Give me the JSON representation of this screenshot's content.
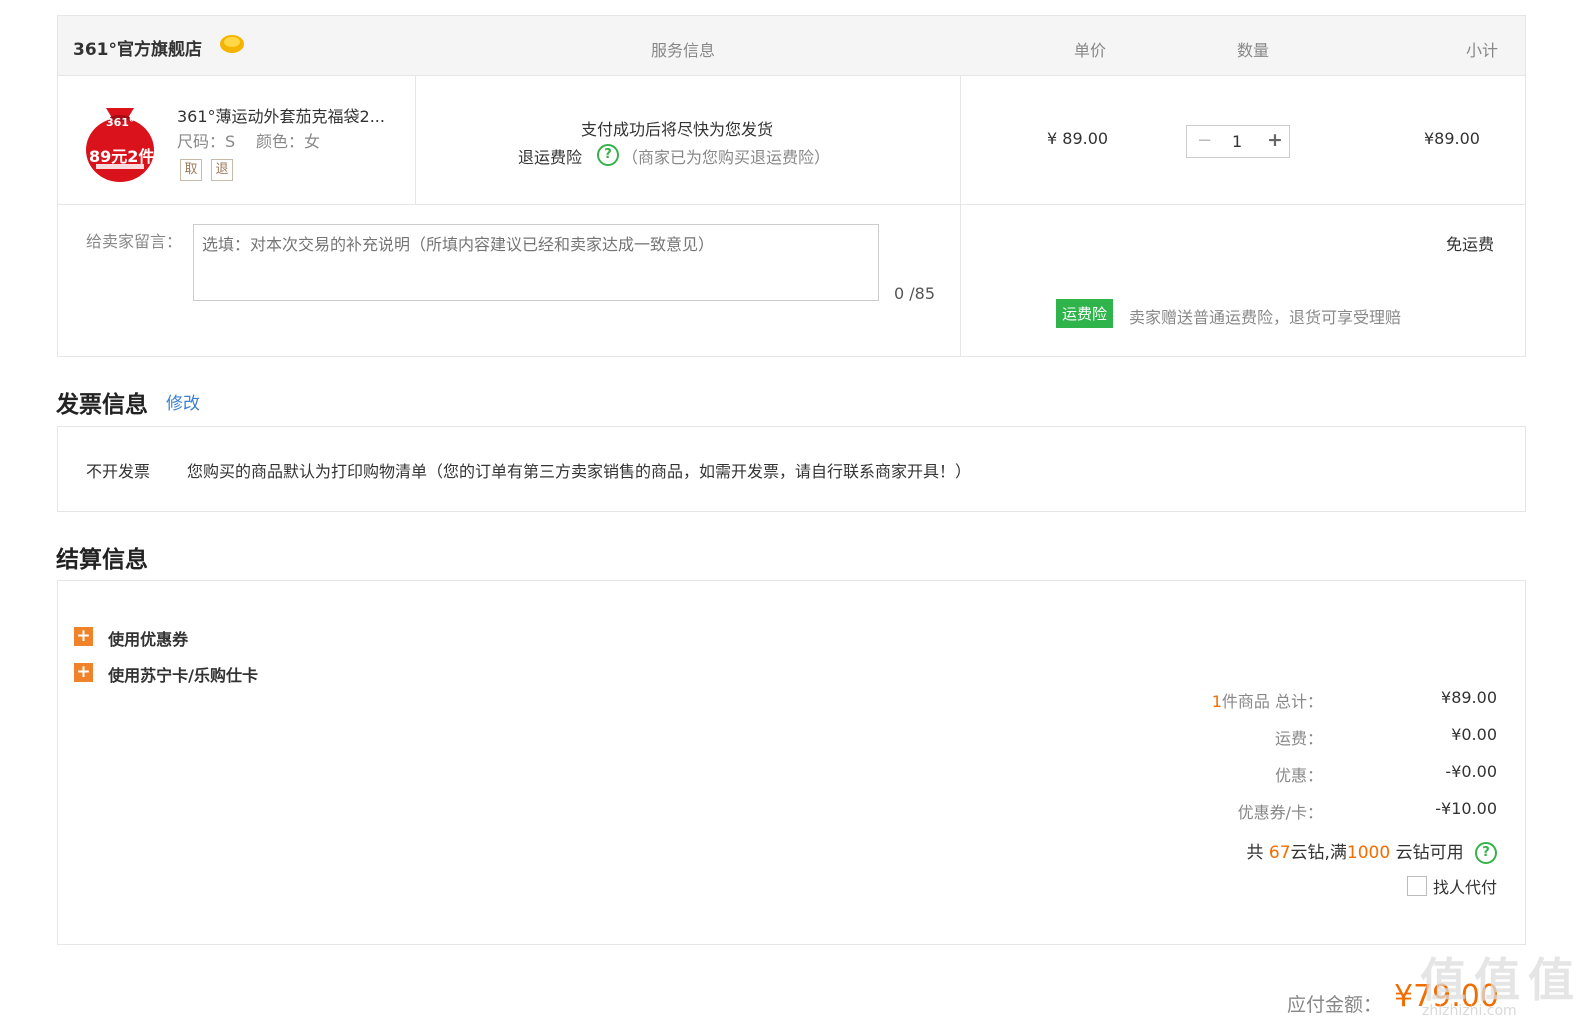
{
  "store": {
    "name": "361°官方旗舰店",
    "service_header": "服务信息",
    "unit_price_header": "单价",
    "quantity_header": "数量",
    "subtotal_header": "小计"
  },
  "product": {
    "badge_brand": "361°",
    "badge_text": "89元2件",
    "title": "361°薄运动外套茄克福袋2...",
    "size": "尺码：S",
    "color": "颜色：女",
    "tag_1": "取",
    "tag_2": "退",
    "shipping_note": "支付成功后将尽快为您发货",
    "return_ins_label": "退运费险",
    "return_ins_note": "（商家已为您购买退运费险）",
    "unit_price": "¥ 89.00",
    "quantity": "1",
    "subtotal": "¥89.00"
  },
  "message": {
    "label": "给卖家留言：",
    "placeholder": "选填：对本次交易的补充说明（所填内容建议已经和卖家达成一致意见）",
    "counter": "0 /85"
  },
  "freight": {
    "free_label": "免运费",
    "badge": "运费险",
    "note": "卖家赠送普通运费险，退货可享受理赔"
  },
  "invoice": {
    "title": "发票信息",
    "edit": "修改",
    "type": "不开发票",
    "desc": "您购买的商品默认为打印购物清单（您的订单有第三方卖家销售的商品，如需开发票，请自行联系商家开具！）"
  },
  "settlement": {
    "title": "结算信息",
    "use_coupon": "使用优惠券",
    "use_card": "使用苏宁卡/乐购仕卡",
    "item_count": "1",
    "item_total_label": "件商品 总计：",
    "item_total": "¥89.00",
    "shipping_label": "运费：",
    "shipping": "¥0.00",
    "discount_label": "优惠：",
    "discount": "-¥0.00",
    "coupon_label": "优惠券/卡：",
    "coupon": "-¥10.00",
    "diamond_pre": "共 ",
    "diamond_count": "67",
    "diamond_mid": "云钻,满",
    "diamond_min": "1000",
    "diamond_post": " 云钻可用",
    "pay_for_me": "找人代付"
  },
  "payable": {
    "label": "应付金额：",
    "amount": "¥79.00"
  },
  "watermark": {
    "text": "值 值 值",
    "sub": "zhizhizhi.com"
  },
  "colors": {
    "orange": "#f26d00",
    "green": "#36b24a",
    "link": "#3b7fd1",
    "border": "#e6e6e6"
  }
}
